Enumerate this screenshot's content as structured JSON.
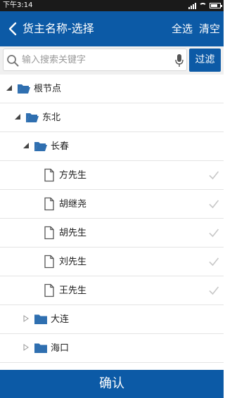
{
  "status_bar": {
    "time": "下午3:14"
  },
  "app_bar": {
    "title": "货主名称-选择",
    "select_all": "全选",
    "clear": "清空"
  },
  "search": {
    "placeholder": "输入搜索关键字",
    "value": "",
    "filter_label": "过滤"
  },
  "tree": {
    "nodes": [
      {
        "label": "根节点",
        "type": "folder",
        "expanded": true
      },
      {
        "label": "东北",
        "type": "folder",
        "expanded": true
      },
      {
        "label": "长春",
        "type": "folder",
        "expanded": true
      },
      {
        "label": "方先生",
        "type": "file",
        "checked": false
      },
      {
        "label": "胡继尧",
        "type": "file",
        "checked": false
      },
      {
        "label": "胡先生",
        "type": "file",
        "checked": false
      },
      {
        "label": "刘先生",
        "type": "file",
        "checked": false
      },
      {
        "label": "王先生",
        "type": "file",
        "checked": false
      },
      {
        "label": "大连",
        "type": "folder",
        "expanded": false
      },
      {
        "label": "海口",
        "type": "folder",
        "expanded": false
      }
    ]
  },
  "confirm_label": "确认",
  "colors": {
    "primary": "#0c5aa6",
    "folder": "#2f6fb0",
    "check": "#c8c8c8"
  }
}
